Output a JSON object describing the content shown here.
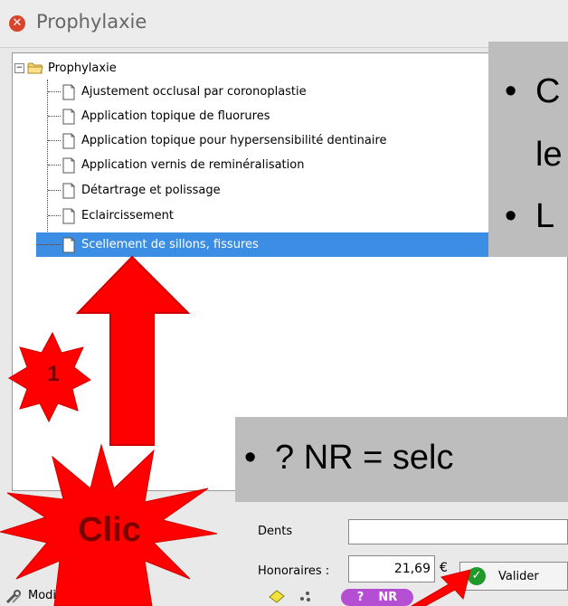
{
  "window": {
    "title": "Prophylaxie",
    "close_glyph": "✕"
  },
  "tree": {
    "root_label": "Prophylaxie",
    "expander_glyph": "−",
    "items": [
      {
        "label": "Ajustement occlusal par coronoplastie"
      },
      {
        "label": "Application topique de fluorures"
      },
      {
        "label": "Application topique pour hypersensibilité dentinaire"
      },
      {
        "label": "Application vernis de reminéralisation"
      },
      {
        "label": "Détartrage et polissage"
      },
      {
        "label": "Eclaircissement"
      },
      {
        "label": "Scellement de sillons, fissures",
        "selected": true
      }
    ]
  },
  "form": {
    "dents_label": "Dents",
    "dents_value": "",
    "honoraires_label": "Honoraires :",
    "honoraires_value": "21,69",
    "currency": "€",
    "valider_label": "Valider",
    "check_glyph": "✓",
    "modifier_label": "Modifier la liste",
    "nr_question": "?",
    "nr_label": "NR"
  },
  "callouts": {
    "top_bullet": "•",
    "top_line1": "C",
    "top_line2": "le",
    "top_line3": "L",
    "bottom_text": "? NR = selc"
  },
  "annotations": {
    "step_number": "1",
    "clic_label": "Clic"
  },
  "colors": {
    "selection": "#3b8ee4",
    "nr_badge": "#b44fd4",
    "valider_check": "#1f9a2a",
    "close_button": "#d9452c",
    "annotation_red": "#ff0000",
    "annotation_text": "#7a0000"
  }
}
